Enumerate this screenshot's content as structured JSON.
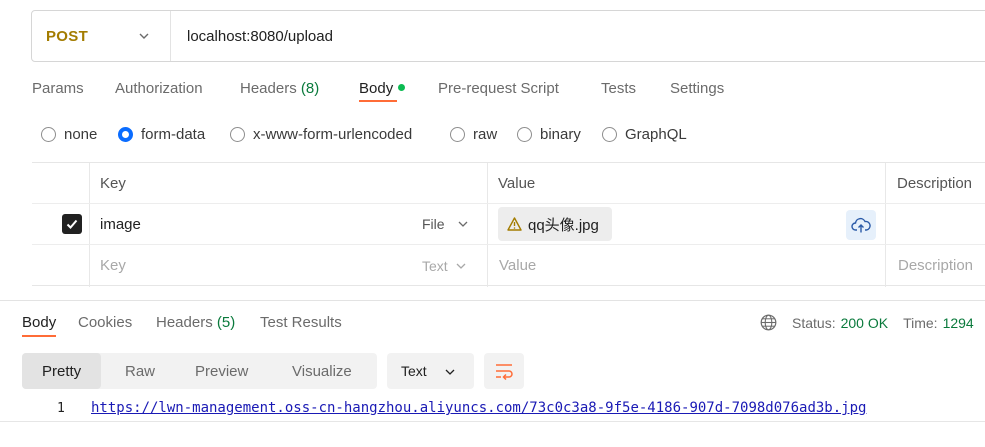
{
  "request": {
    "method": "POST",
    "url": "localhost:8080/upload"
  },
  "request_tabs": [
    {
      "label": "Params"
    },
    {
      "label": "Authorization"
    },
    {
      "label": "Headers",
      "count": "(8)"
    },
    {
      "label": "Body"
    },
    {
      "label": "Pre-request Script"
    },
    {
      "label": "Tests"
    },
    {
      "label": "Settings"
    }
  ],
  "body_types": [
    {
      "label": "none"
    },
    {
      "label": "form-data"
    },
    {
      "label": "x-www-form-urlencoded"
    },
    {
      "label": "raw"
    },
    {
      "label": "binary"
    },
    {
      "label": "GraphQL"
    }
  ],
  "form_table": {
    "headers": {
      "key": "Key",
      "value": "Value",
      "description": "Description"
    },
    "rows": [
      {
        "key": "image",
        "type": "File",
        "value": "qq头像.jpg"
      }
    ],
    "empty_row": {
      "key": "Key",
      "type": "Text",
      "value": "Value",
      "description": "Description"
    }
  },
  "response_tabs": [
    {
      "label": "Body"
    },
    {
      "label": "Cookies"
    },
    {
      "label": "Headers",
      "count": "(5)"
    },
    {
      "label": "Test Results"
    }
  ],
  "status": {
    "status_label": "Status:",
    "status_value": "200 OK",
    "time_label": "Time:",
    "time_value": "1294"
  },
  "view_modes": [
    {
      "label": "Pretty"
    },
    {
      "label": "Raw"
    },
    {
      "label": "Preview"
    },
    {
      "label": "Visualize"
    }
  ],
  "format": "Text",
  "response_body": {
    "line_number": "1",
    "content": "https://lwn-management.oss-cn-hangzhou.aliyuncs.com/73c0c3a8-9f5e-4186-907d-7098d076ad3b.jpg"
  },
  "colors": {
    "method": "#a37c00",
    "accent": "#ff6c37",
    "success": "#0a7a3c",
    "radio_selected": "#0a6cff",
    "link": "#1a1ab5"
  }
}
